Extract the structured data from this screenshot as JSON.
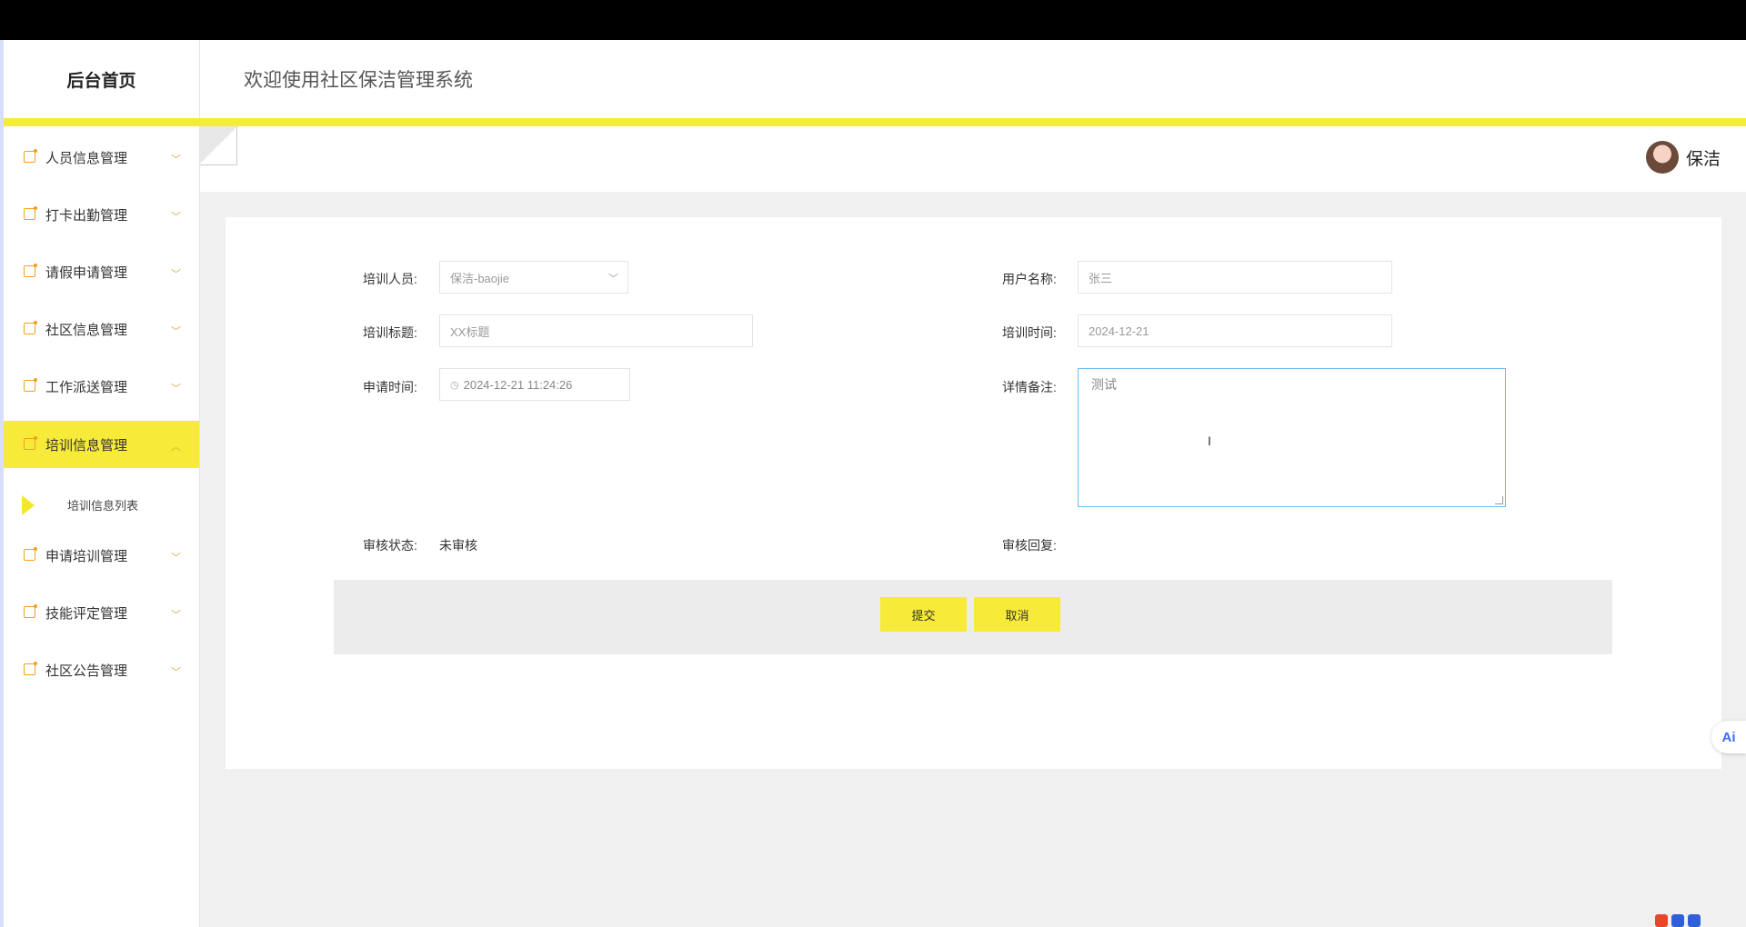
{
  "header": {
    "brand": "后台首页",
    "system_title": "欢迎使用社区保洁管理系统"
  },
  "user": {
    "name": "保洁"
  },
  "sidebar": {
    "items": [
      {
        "label": "人员信息管理",
        "arrow": "﹀"
      },
      {
        "label": "打卡出勤管理",
        "arrow": "﹀"
      },
      {
        "label": "请假申请管理",
        "arrow": "﹀"
      },
      {
        "label": "社区信息管理",
        "arrow": "﹀"
      },
      {
        "label": "工作派送管理",
        "arrow": "﹀"
      },
      {
        "label": "培训信息管理",
        "arrow": "︿",
        "active": true
      },
      {
        "label": "申请培训管理",
        "arrow": "﹀"
      },
      {
        "label": "技能评定管理",
        "arrow": "﹀"
      },
      {
        "label": "社区公告管理",
        "arrow": "﹀"
      }
    ],
    "submenu": {
      "label": "培训信息列表"
    }
  },
  "form": {
    "trainee_label": "培训人员:",
    "trainee_value": "保洁-baojie",
    "username_label": "用户名称:",
    "username_value": "张三",
    "title_label": "培训标题:",
    "title_value": "XX标题",
    "train_time_label": "培训时间:",
    "train_time_value": "2024-12-21",
    "apply_time_label": "申请时间:",
    "apply_time_value": "2024-12-21 11:24:26",
    "remark_label": "详情备注:",
    "remark_value": "测试",
    "review_status_label": "审核状态:",
    "review_status_value": "未审核",
    "review_reply_label": "审核回复:",
    "review_reply_value": ""
  },
  "buttons": {
    "submit": "提交",
    "cancel": "取消"
  },
  "floating": {
    "ai_label": "Ai"
  },
  "icons": {
    "menu_icon": "note-icon",
    "clock_icon": "clock-icon",
    "accent_color": "#f8ea38",
    "icon_color": "#f0a020"
  }
}
